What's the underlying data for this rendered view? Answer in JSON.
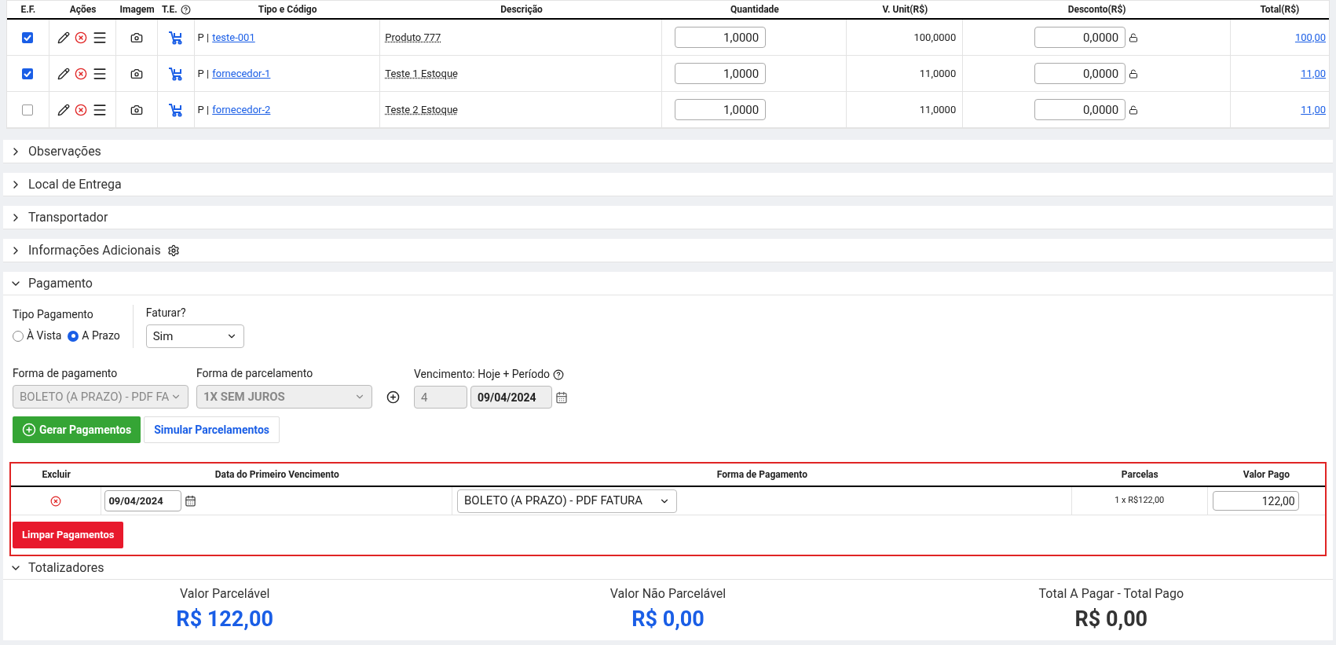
{
  "items_table": {
    "columns": [
      "E.F.",
      "Ações",
      "Imagem",
      "T.E.",
      "Tipo e Código",
      "Descrição",
      "Quantidade",
      "V. Unit(R$)",
      "Desconto(R$)",
      "Total(R$)"
    ],
    "rows": [
      {
        "checked": true,
        "type": "P |",
        "code": "teste-001",
        "description": "Produto 777",
        "quantity": "1,0000",
        "unit_price": "100,0000",
        "discount": "0,0000",
        "total": "100,00"
      },
      {
        "checked": true,
        "type": "P |",
        "code": "fornecedor-1",
        "description": "Teste 1 Estoque",
        "quantity": "1,0000",
        "unit_price": "11,0000",
        "discount": "0,0000",
        "total": "11,00"
      },
      {
        "checked": false,
        "type": "P |",
        "code": "fornecedor-2",
        "description": "Teste 2 Estoque",
        "quantity": "1,0000",
        "unit_price": "11,0000",
        "discount": "0,0000",
        "total": "11,00"
      }
    ]
  },
  "sections": [
    {
      "label": "Observações",
      "expanded": false,
      "settings_icon": false
    },
    {
      "label": "Local de Entrega",
      "expanded": false,
      "settings_icon": false
    },
    {
      "label": "Transportador",
      "expanded": false,
      "settings_icon": false
    },
    {
      "label": "Informações Adicionais",
      "expanded": false,
      "settings_icon": true
    }
  ],
  "payment": {
    "label": "Pagamento",
    "expanded": true,
    "payment_type": {
      "label": "Tipo Pagamento",
      "options": [
        {
          "label": "À Vista",
          "selected": false
        },
        {
          "label": "A Prazo",
          "selected": true
        }
      ]
    },
    "invoice": {
      "label": "Faturar?",
      "value": "Sim"
    },
    "payment_method": {
      "label": "Forma de pagamento",
      "value": "BOLETO (A PRAZO) - PDF FA",
      "disabled": true
    },
    "installment_method": {
      "label": "Forma de parcelamento",
      "value": "1X SEM JUROS",
      "disabled": true
    },
    "due": {
      "label": "Vencimento: Hoje + Período",
      "days": "4",
      "date": "09/04/2024",
      "disabled": true
    },
    "generate_button": "Gerar Pagamentos",
    "simulate_button": "Simular Parcelamentos",
    "table": {
      "columns": [
        "Excluir",
        "Data do Primeiro Vencimento",
        "Forma de Pagamento",
        "Parcelas",
        "Valor Pago"
      ],
      "rows": [
        {
          "date": "09/04/2024",
          "method": "BOLETO (A PRAZO) - PDF FATURA",
          "installments": "1 x R$122,00",
          "paid": "122,00"
        }
      ]
    },
    "clear_button": "Limpar Pagamentos"
  },
  "totals": {
    "label": "Totalizadores",
    "expanded": true,
    "items": [
      {
        "label": "Valor Parcelável",
        "value": "R$ 122,00",
        "color": "#1a5ee6"
      },
      {
        "label": "Valor Não Parcelável",
        "value": "R$ 0,00",
        "color": "#1a5ee6"
      },
      {
        "label": "Total A Pagar - Total Pago",
        "value": "R$ 0,00",
        "color": "#333333"
      }
    ]
  }
}
